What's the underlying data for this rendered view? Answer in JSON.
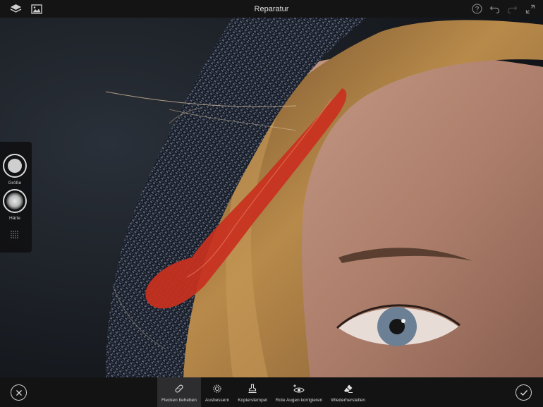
{
  "header": {
    "title": "Reparatur"
  },
  "brush_panel": {
    "size_label": "Größe",
    "hardness_label": "Härte"
  },
  "tools": [
    {
      "label": "Flecken beheben",
      "icon": "bandage-icon",
      "active": true
    },
    {
      "label": "Ausbessern",
      "icon": "patch-icon",
      "active": false
    },
    {
      "label": "Kopierstempel",
      "icon": "stamp-icon",
      "active": false
    },
    {
      "label": "Rote Augen korrigieren",
      "icon": "red-eye-icon",
      "active": false
    },
    {
      "label": "Wiederherstellen",
      "icon": "eraser-icon",
      "active": false
    }
  ],
  "colors": {
    "brush_stroke": "#c8301f",
    "bar_background": "#131314"
  }
}
